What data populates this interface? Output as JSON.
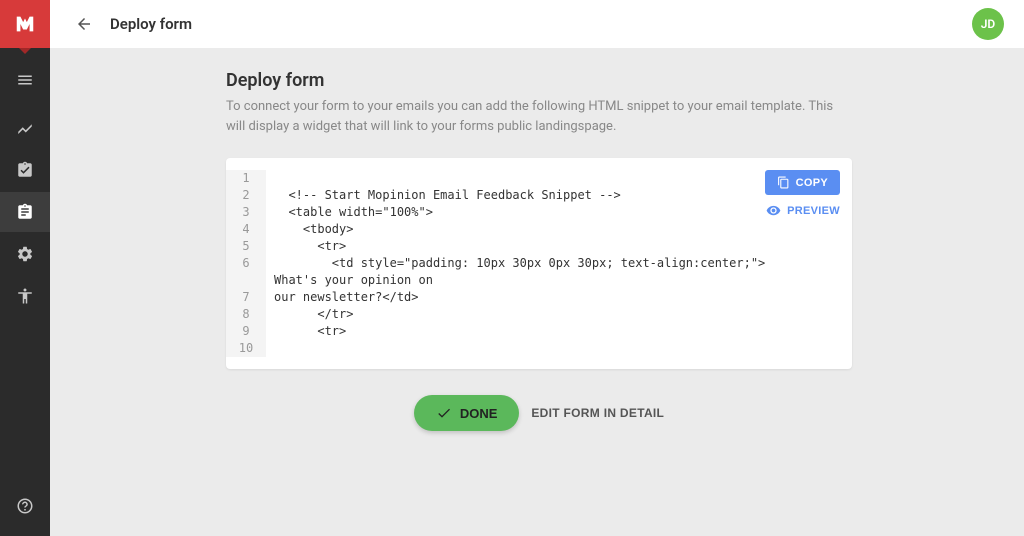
{
  "topbar": {
    "title": "Deploy form",
    "avatar_initials": "JD"
  },
  "page": {
    "title": "Deploy form",
    "description": "To connect your form to your emails you can add the following HTML snippet to your email template. This will display a widget that will link to your forms public landingspage."
  },
  "code": {
    "lines": [
      "",
      "  <!-- Start Mopinion Email Feedback Snippet -->",
      "  <table width=\"100%\">",
      "    <tbody>",
      "      <tr>",
      "        <td style=\"padding: 10px 30px 0px 30px; text-align:center;\">What's your opinion on our newsletter?</td>",
      "      </tr>",
      "      <tr>",
      ""
    ]
  },
  "actions": {
    "copy": "COPY",
    "preview": "PREVIEW",
    "done": "DONE",
    "edit_detail": "EDIT FORM IN DETAIL"
  }
}
